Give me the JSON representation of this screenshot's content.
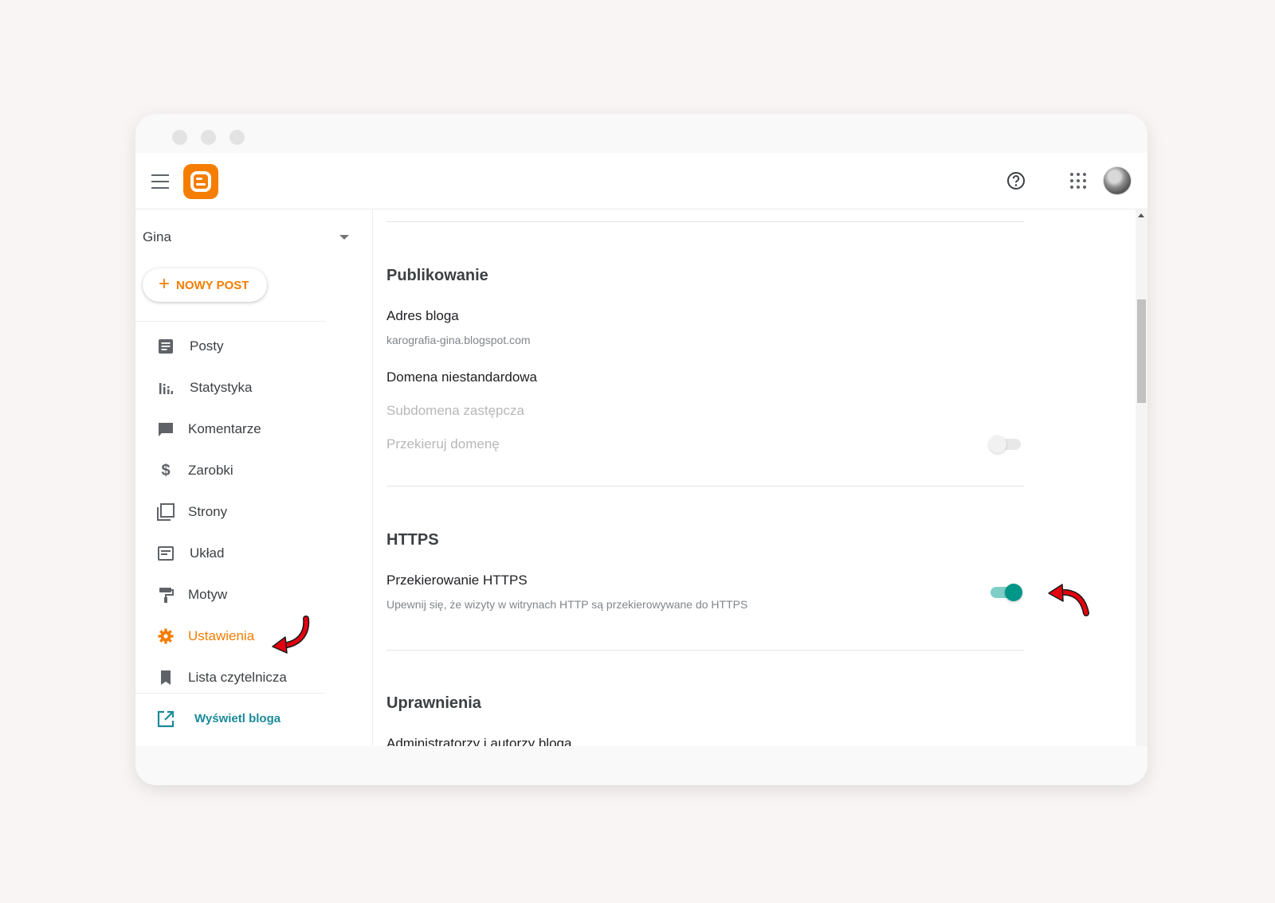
{
  "header": {
    "app": "Blogger",
    "icons": [
      "menu-icon",
      "blogger-logo",
      "help-icon",
      "apps-grid-icon",
      "avatar"
    ]
  },
  "sidebar": {
    "blog_name": "Gina",
    "new_post_label": "NOWY POST",
    "items": [
      {
        "label": "Posty",
        "icon": "posts-icon"
      },
      {
        "label": "Statystyka",
        "icon": "stats-icon"
      },
      {
        "label": "Komentarze",
        "icon": "comments-icon"
      },
      {
        "label": "Zarobki",
        "icon": "dollar-icon"
      },
      {
        "label": "Strony",
        "icon": "pages-icon"
      },
      {
        "label": "Układ",
        "icon": "layout-icon"
      },
      {
        "label": "Motyw",
        "icon": "paint-roller-icon"
      },
      {
        "label": "Ustawienia",
        "icon": "gear-icon",
        "active": true
      },
      {
        "label": "Lista czytelnicza",
        "icon": "bookmark-icon"
      }
    ],
    "view_blog_label": "Wyświetl bloga"
  },
  "content": {
    "publishing": {
      "title": "Publikowanie",
      "blog_address_label": "Adres bloga",
      "blog_address_value": "karografia-gina.blogspot.com",
      "custom_domain_label": "Domena niestandardowa",
      "fallback_subdomain_label": "Subdomena zastępcza",
      "redirect_domain_label": "Przekieruj domenę",
      "redirect_domain_enabled": false
    },
    "https": {
      "title": "HTTPS",
      "redirect_label": "Przekierowanie HTTPS",
      "redirect_desc": "Upewnij się, że wizyty w witrynach HTTP są przekierowywane do HTTPS",
      "redirect_enabled": true
    },
    "permissions": {
      "title": "Uprawnienia",
      "admins_label": "Administratorzy i autorzy bloga"
    }
  },
  "colors": {
    "accent": "#f57d00",
    "toggle_on": "#009688",
    "link": "#1a8a9a",
    "annotation_arrow": "#e3000f"
  }
}
